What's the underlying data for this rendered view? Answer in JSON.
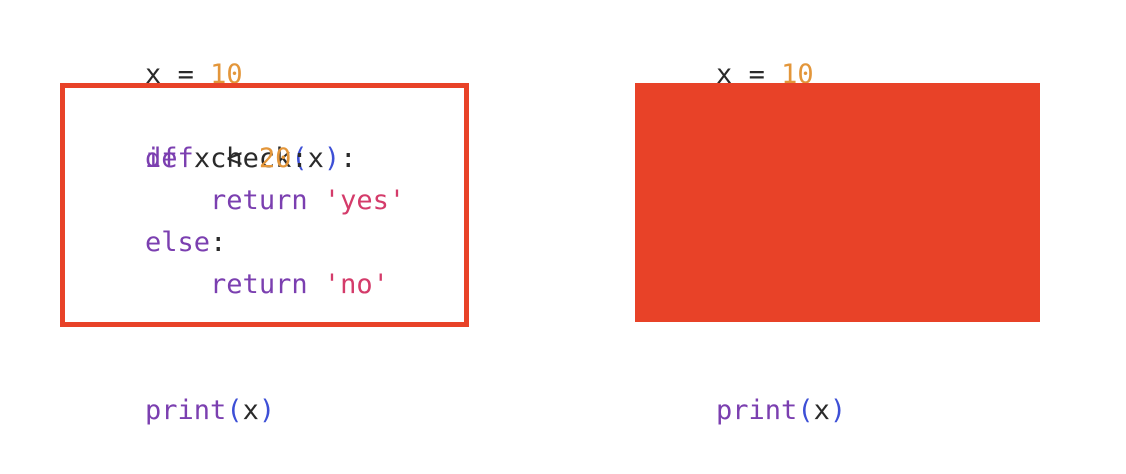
{
  "left": {
    "assign": {
      "var": "x",
      "op": "=",
      "value": "10"
    },
    "function": {
      "def_kw": "def",
      "name": "check",
      "open_paren": "(",
      "param": "x",
      "close_paren": ")",
      "colon": ":",
      "if_kw": "if",
      "cond_var": "x",
      "cond_op": "<",
      "cond_value": "20",
      "if_colon": ":",
      "return_kw_1": "return",
      "return_val_1": "'yes'",
      "else_kw": "else",
      "else_colon": ":",
      "return_kw_2": "return",
      "return_val_2": "'no'"
    },
    "print": {
      "fn": "print",
      "open_paren": "(",
      "arg": "x",
      "close_paren": ")"
    }
  },
  "right": {
    "assign": {
      "var": "x",
      "op": "=",
      "value": "10"
    },
    "print": {
      "fn": "print",
      "open_paren": "(",
      "arg": "x",
      "close_paren": ")"
    }
  },
  "colors": {
    "highlight_red": "#e84228",
    "keyword_purple": "#7b3fb0",
    "paren_blue": "#3d4fd6",
    "number_orange": "#e3963a",
    "string_pink": "#d43b6a"
  }
}
